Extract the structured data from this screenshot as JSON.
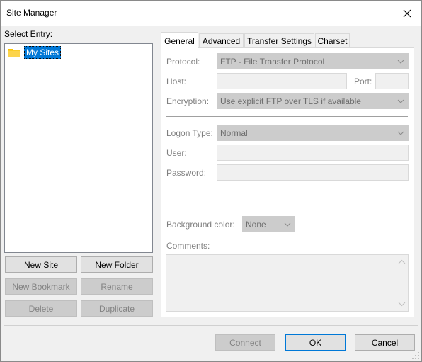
{
  "window": {
    "title": "Site Manager",
    "close_icon": "close-icon"
  },
  "left": {
    "select_entry_label": "Select Entry:",
    "tree": [
      {
        "label": "My Sites",
        "icon": "folder-icon",
        "selected": true
      }
    ],
    "buttons": {
      "new_site": "New Site",
      "new_folder": "New Folder",
      "new_bookmark": "New Bookmark",
      "rename": "Rename",
      "delete": "Delete",
      "duplicate": "Duplicate"
    }
  },
  "tabs": [
    {
      "label": "General",
      "active": true
    },
    {
      "label": "Advanced",
      "active": false
    },
    {
      "label": "Transfer Settings",
      "active": false
    },
    {
      "label": "Charset",
      "active": false
    }
  ],
  "general": {
    "protocol_label": "Protocol:",
    "protocol_value": "FTP - File Transfer Protocol",
    "host_label": "Host:",
    "host_value": "",
    "port_label": "Port:",
    "port_value": "",
    "encryption_label": "Encryption:",
    "encryption_value": "Use explicit FTP over TLS if available",
    "logon_type_label": "Logon Type:",
    "logon_type_value": "Normal",
    "user_label": "User:",
    "user_value": "",
    "password_label": "Password:",
    "password_value": "",
    "background_color_label": "Background color:",
    "background_color_value": "None",
    "comments_label": "Comments:",
    "comments_value": ""
  },
  "footer": {
    "connect": "Connect",
    "ok": "OK",
    "cancel": "Cancel"
  },
  "colors": {
    "accent": "#0078d7",
    "disabled_text": "#838383",
    "folder": "#f9c300"
  }
}
